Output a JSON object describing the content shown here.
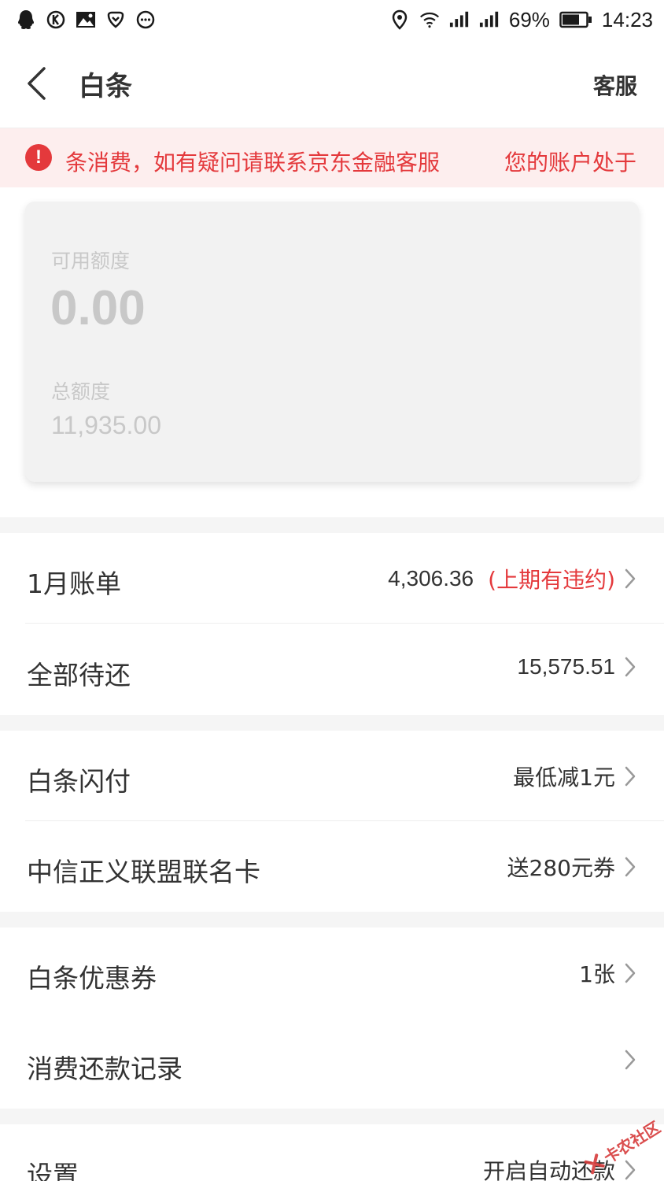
{
  "status_bar": {
    "icons_left": [
      "qq-icon",
      "k-app-icon",
      "image-icon",
      "shield-heart-icon",
      "more-dots-icon"
    ],
    "icons_right": [
      "location-icon",
      "wifi-icon",
      "signal-icon",
      "signal-icon-2",
      "battery-icon"
    ],
    "battery": "69%",
    "time": "14:23"
  },
  "nav": {
    "title": "白条",
    "service": "客服"
  },
  "alert": {
    "text": "条消费，如有疑问请联系京东金融客服",
    "text_continued": "您的账户处于",
    "color": "#e4393c",
    "background": "#fdeeee"
  },
  "credit": {
    "available_label": "可用额度",
    "available_amount": "0.00",
    "total_label": "总额度",
    "total_amount": "11,935.00"
  },
  "rows": [
    {
      "label": "1月账单",
      "value": "4,306.36",
      "warning": "(上期有违约)"
    },
    {
      "label": "全部待还",
      "value": "15,575.51"
    },
    {
      "label": "白条闪付",
      "value": "最低减1元"
    },
    {
      "label": "中信正义联盟联名卡",
      "value": "送280元券"
    },
    {
      "label": "白条优惠券",
      "value": "1张"
    },
    {
      "label": "消费还款记录",
      "value": ""
    },
    {
      "label": "设置",
      "value": "开启自动还款"
    }
  ],
  "watermark": {
    "text": "卡农社区"
  }
}
